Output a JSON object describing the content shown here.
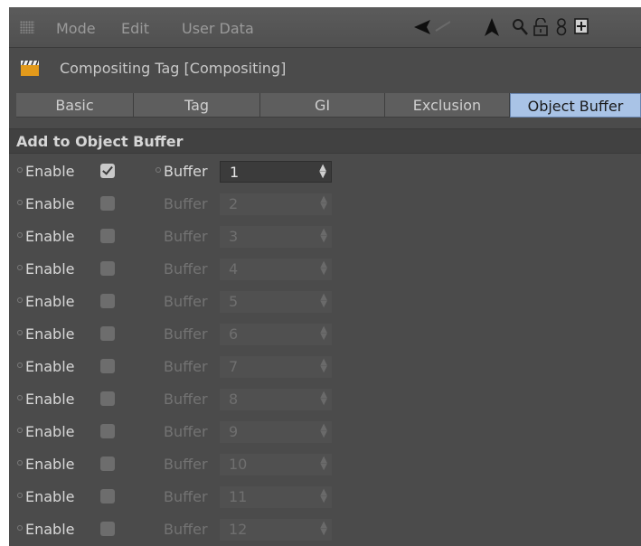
{
  "menu": {
    "items": [
      "Mode",
      "Edit",
      "User Data"
    ],
    "toolbar_icons": [
      "back-arrow-icon",
      "cursor-arrow-icon",
      "search-icon",
      "lock-icon",
      "link-icon",
      "new-panel-icon"
    ]
  },
  "title": "Compositing Tag [Compositing]",
  "tabs": [
    {
      "label": "Basic",
      "active": false
    },
    {
      "label": "Tag",
      "active": false
    },
    {
      "label": "GI",
      "active": false
    },
    {
      "label": "Exclusion",
      "active": false
    },
    {
      "label": "Object Buffer",
      "active": true
    }
  ],
  "section_title": "Add to Object Buffer",
  "rows": [
    {
      "enable_label": "Enable",
      "enabled": true,
      "buffer_label": "Buffer",
      "buffer_value": "1"
    },
    {
      "enable_label": "Enable",
      "enabled": false,
      "buffer_label": "Buffer",
      "buffer_value": "2"
    },
    {
      "enable_label": "Enable",
      "enabled": false,
      "buffer_label": "Buffer",
      "buffer_value": "3"
    },
    {
      "enable_label": "Enable",
      "enabled": false,
      "buffer_label": "Buffer",
      "buffer_value": "4"
    },
    {
      "enable_label": "Enable",
      "enabled": false,
      "buffer_label": "Buffer",
      "buffer_value": "5"
    },
    {
      "enable_label": "Enable",
      "enabled": false,
      "buffer_label": "Buffer",
      "buffer_value": "6"
    },
    {
      "enable_label": "Enable",
      "enabled": false,
      "buffer_label": "Buffer",
      "buffer_value": "7"
    },
    {
      "enable_label": "Enable",
      "enabled": false,
      "buffer_label": "Buffer",
      "buffer_value": "8"
    },
    {
      "enable_label": "Enable",
      "enabled": false,
      "buffer_label": "Buffer",
      "buffer_value": "9"
    },
    {
      "enable_label": "Enable",
      "enabled": false,
      "buffer_label": "Buffer",
      "buffer_value": "10"
    },
    {
      "enable_label": "Enable",
      "enabled": false,
      "buffer_label": "Buffer",
      "buffer_value": "11"
    },
    {
      "enable_label": "Enable",
      "enabled": false,
      "buffer_label": "Buffer",
      "buffer_value": "12"
    }
  ],
  "colors": {
    "panel_bg": "#4b4b4b",
    "active_tab": "#a9c3e6",
    "text": "#d8d8d8",
    "dim_text": "#737373"
  }
}
